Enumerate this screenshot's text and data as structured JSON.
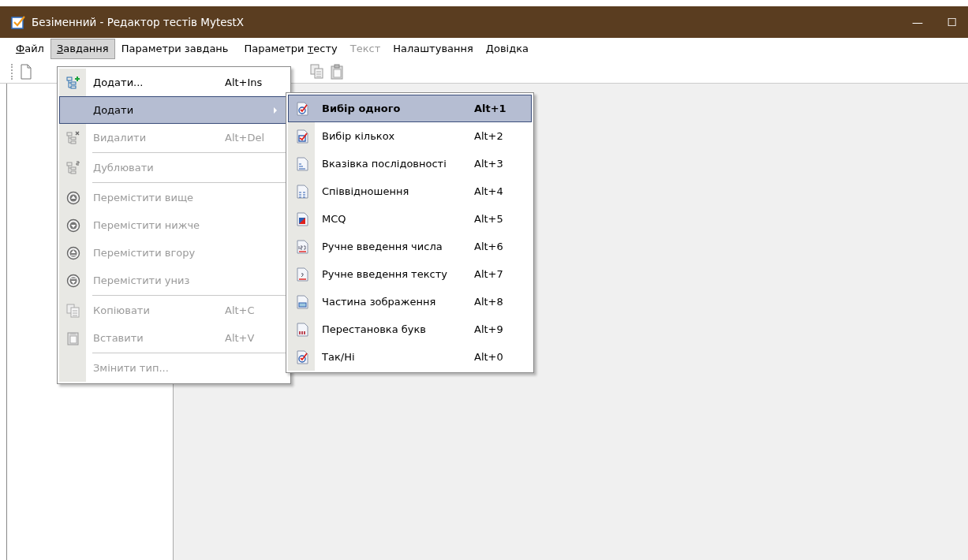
{
  "window": {
    "title": "Безіменний - Редактор тестів MytestX",
    "controls": [
      "—",
      "☐"
    ]
  },
  "menu_bar": [
    {
      "access_key": "Ф",
      "label_rest": "айл",
      "selected": false,
      "disabled": false
    },
    {
      "access_key": "З",
      "label_rest": "авдання",
      "selected": true,
      "disabled": false
    },
    {
      "label_start": "Параметри завдань",
      "selected": false,
      "disabled": false
    },
    {
      "label_start": "Параметри ",
      "access_key": "т",
      "label_rest": "есту",
      "selected": false,
      "disabled": false
    },
    {
      "label_start": "Текст",
      "selected": false,
      "disabled": true
    },
    {
      "label_start": "Налаштування",
      "selected": false,
      "disabled": false
    },
    {
      "access_key": "Д",
      "label_rest": "овідка",
      "selected": false,
      "disabled": false
    }
  ],
  "dropdown": [
    {
      "kind": "item",
      "label": "Додати...",
      "shortcut": "Alt+Ins",
      "disabled": false,
      "selected": false
    },
    {
      "kind": "submenu",
      "label": "Додати",
      "disabled": false,
      "selected": true
    },
    {
      "kind": "item",
      "label": "Видалити",
      "shortcut": "Alt+Del",
      "disabled": true,
      "selected": false
    },
    {
      "kind": "separator"
    },
    {
      "kind": "item",
      "label": "Дублювати",
      "disabled": true,
      "selected": false
    },
    {
      "kind": "separator"
    },
    {
      "kind": "item",
      "label": "Перемістити вище",
      "disabled": true,
      "selected": false
    },
    {
      "kind": "item",
      "label": "Перемістити нижче",
      "disabled": true,
      "selected": false
    },
    {
      "kind": "item",
      "label": "Перемістити вгору",
      "disabled": true,
      "selected": false
    },
    {
      "kind": "item",
      "label": "Перемістити униз",
      "disabled": true,
      "selected": false
    },
    {
      "kind": "separator"
    },
    {
      "kind": "item",
      "label": "Копіювати",
      "shortcut": "Alt+C",
      "disabled": true,
      "selected": false
    },
    {
      "kind": "item",
      "label": "Вставити",
      "shortcut": "Alt+V",
      "disabled": true,
      "selected": false
    },
    {
      "kind": "separator"
    },
    {
      "kind": "item",
      "label": "Змінити тип...",
      "disabled": true,
      "selected": false
    }
  ],
  "submenu": [
    {
      "label": "Вибір одного",
      "shortcut": "Alt+1",
      "selected": true
    },
    {
      "label": "Вибір кількох",
      "shortcut": "Alt+2",
      "selected": false
    },
    {
      "label": "Вказівка послідовності",
      "shortcut": "Alt+3",
      "selected": false
    },
    {
      "label": "Співвідношення",
      "shortcut": "Alt+4",
      "selected": false
    },
    {
      "label": "MCQ",
      "shortcut": "Alt+5",
      "selected": false
    },
    {
      "label": "Ручне введення числа",
      "shortcut": "Alt+6",
      "selected": false
    },
    {
      "label": "Ручне введення тексту",
      "shortcut": "Alt+7",
      "selected": false
    },
    {
      "label": "Частина зображення",
      "shortcut": "Alt+8",
      "selected": false
    },
    {
      "label": "Перестановка букв",
      "shortcut": "Alt+9",
      "selected": false
    },
    {
      "label": "Так/Ні",
      "shortcut": "Alt+0",
      "selected": false
    }
  ]
}
